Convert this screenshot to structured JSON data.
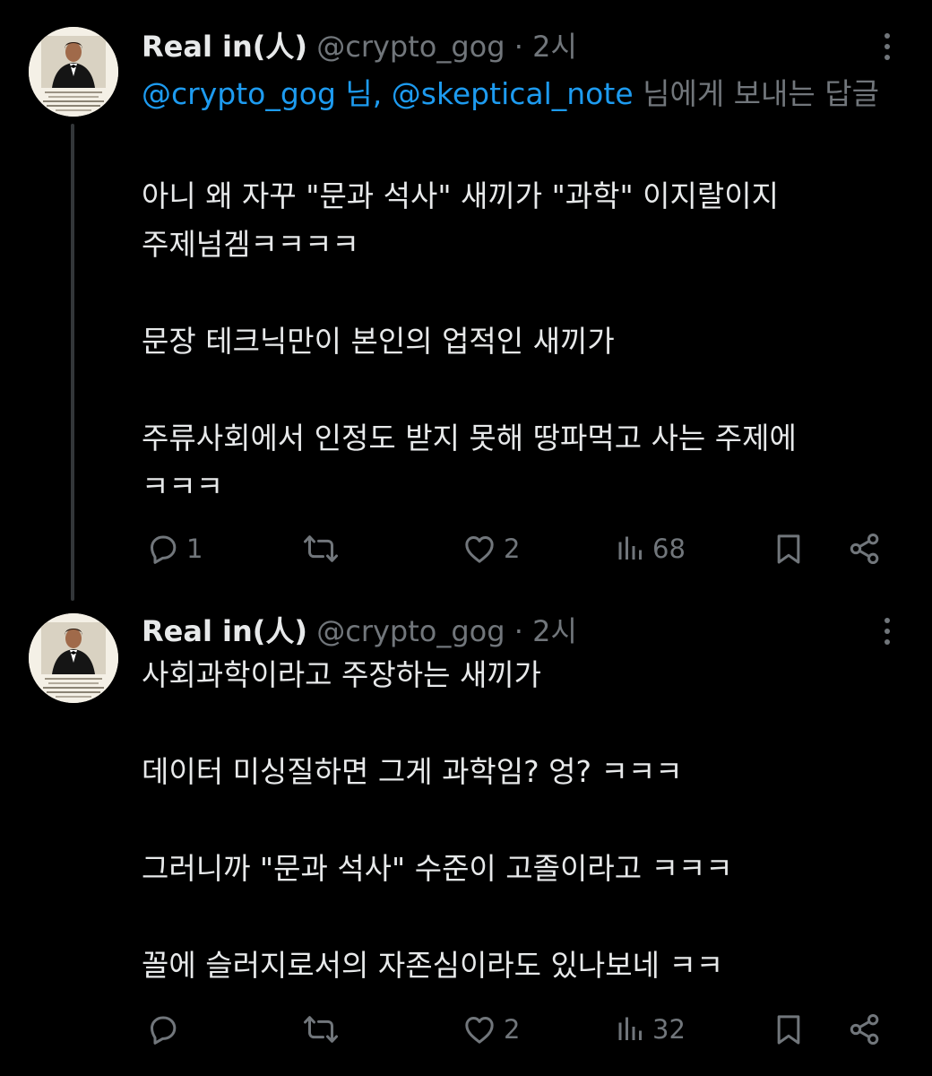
{
  "colors": {
    "background": "#000000",
    "text": "#e7e9ea",
    "muted": "#71767b",
    "link": "#1d9bf0",
    "thread_line": "#333639"
  },
  "tweets": [
    {
      "author": {
        "name": "Real in(人)",
        "handle": "@crypto_gog",
        "separator": "·",
        "time": "2시",
        "avatar": "avatar-man-in-tuxedo"
      },
      "reply_to": {
        "mention_1": "@crypto_gog 님,",
        "mention_2": "@skeptical_note",
        "suffix": " 님에게 보내는 답글"
      },
      "lines": [
        "아니 왜 자꾸 \"문과 석사\" 새끼가 \"과학\" 이지랄이지",
        "주제넘겜ㅋㅋㅋㅋ",
        "",
        "문장 테크닉만이 본인의 업적인 새끼가",
        "",
        "주류사회에서 인정도 받지 못해 땅파먹고 사는 주제에",
        "ㅋㅋㅋ"
      ],
      "stats": {
        "replies": "1",
        "reposts": "",
        "likes": "2",
        "views": "68"
      }
    },
    {
      "author": {
        "name": "Real in(人)",
        "handle": "@crypto_gog",
        "separator": "·",
        "time": "2시",
        "avatar": "avatar-man-in-tuxedo"
      },
      "lines": [
        "사회과학이라고 주장하는 새끼가",
        "",
        "데이터 미싱질하면 그게 과학임? 엉? ㅋㅋㅋ",
        "",
        "그러니까 \"문과 석사\" 수준이 고졸이라고 ㅋㅋㅋ",
        "",
        "꼴에 슬러지로서의 자존심이라도 있나보네 ㅋㅋ"
      ],
      "stats": {
        "replies": "",
        "reposts": "",
        "likes": "2",
        "views": "32"
      }
    }
  ]
}
